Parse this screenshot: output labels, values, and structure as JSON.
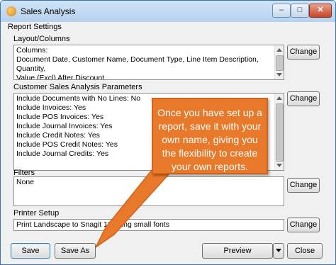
{
  "window": {
    "title": "Sales Analysis",
    "minimize": "‒",
    "maximize": "□",
    "close": "✕"
  },
  "report_settings": {
    "label": "Report Settings"
  },
  "layout_columns": {
    "label": "Layout/Columns",
    "lines": [
      "Columns:",
      "Document Date, Customer Name, Document Type, Line Item Description, Quantity,",
      "Value (Excl) After Discount"
    ],
    "change_label": "Change"
  },
  "parameters": {
    "label": "Customer Sales Analysis Parameters",
    "lines": [
      "Include Documents with No Lines: No",
      "Include Invoices: Yes",
      "Include POS Invoices: Yes",
      "Include Journal Invoices: Yes",
      "Include Credit Notes: Yes",
      "Include POS Credit Notes: Yes",
      "Include Journal Credits: Yes"
    ],
    "change_label": "Change"
  },
  "filters": {
    "label": "Filters",
    "value": "None",
    "change_label": "Change"
  },
  "printer_setup": {
    "label": "Printer Setup",
    "value": "Print Landscape to Snagit 12 using small fonts",
    "change_label": "Change"
  },
  "footer": {
    "save_label": "Save",
    "save_as_label": "Save As",
    "preview_label": "Preview",
    "close_label": "Close"
  },
  "callout": {
    "text": "Once you have set up a report, save it with your own name, giving you the flexibility to create your own reports."
  },
  "colors": {
    "callout": "#e8792a",
    "titlebar": "#cfe3f7"
  }
}
